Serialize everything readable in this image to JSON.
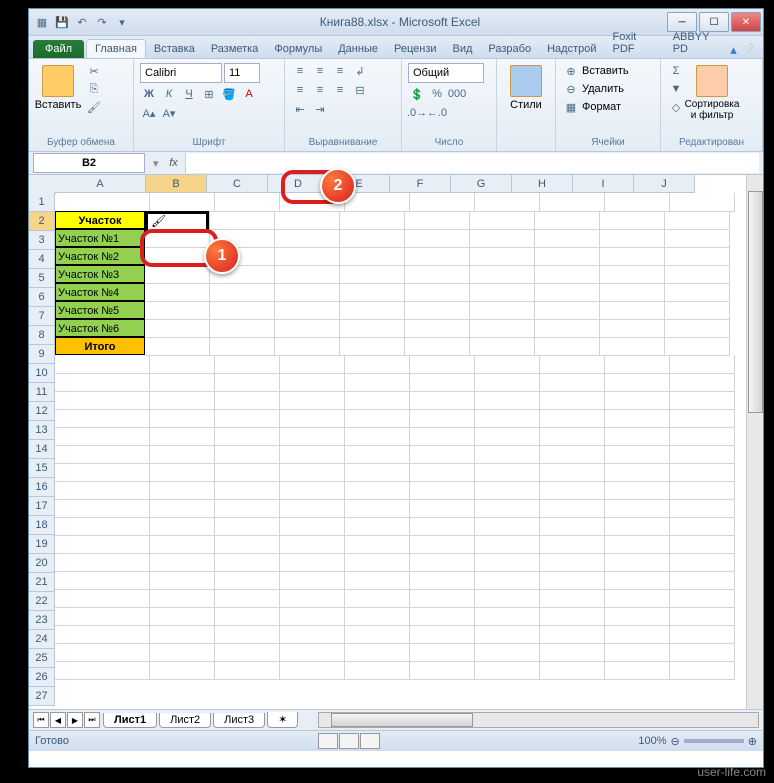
{
  "title": "Книга88.xlsx - Microsoft Excel",
  "qat": {
    "save": "💾",
    "undo": "↶",
    "redo": "↷"
  },
  "tabs": {
    "file": "Файл",
    "items": [
      "Главная",
      "Вставка",
      "Разметка",
      "Формулы",
      "Данные",
      "Рецензи",
      "Вид",
      "Разрабо",
      "Надстрой",
      "Foxit PDF",
      "ABBYY PD"
    ]
  },
  "ribbon": {
    "clipboard": {
      "label": "Буфер обмена",
      "paste": "Вставить"
    },
    "font": {
      "label": "Шрифт",
      "name": "Calibri",
      "size": "11"
    },
    "align": {
      "label": "Выравнивание"
    },
    "number": {
      "label": "Число",
      "format": "Общий"
    },
    "styles": {
      "label": "Стили"
    },
    "cells": {
      "label": "Ячейки",
      "insert": "Вставить",
      "delete": "Удалить",
      "format": "Формат"
    },
    "edit": {
      "label": "Редактирован",
      "sort": "Сортировка и фильтр"
    }
  },
  "namebox": "B2",
  "fx": "fx",
  "columns": [
    "A",
    "B",
    "C",
    "D",
    "E",
    "F",
    "G",
    "H",
    "I",
    "J"
  ],
  "rows_data": {
    "2": {
      "A": "Участок"
    },
    "3": {
      "A": "Участок №1"
    },
    "4": {
      "A": "Участок №2"
    },
    "5": {
      "A": "Участок №3"
    },
    "6": {
      "A": "Участок №4"
    },
    "7": {
      "A": "Участок №5"
    },
    "8": {
      "A": "Участок №6"
    },
    "9": {
      "A": "Итого"
    }
  },
  "sheets": [
    "Лист1",
    "Лист2",
    "Лист3"
  ],
  "status": "Готово",
  "zoom": "100%",
  "annotations": {
    "badge1": "1",
    "badge2": "2"
  },
  "watermark": "user-life.com"
}
